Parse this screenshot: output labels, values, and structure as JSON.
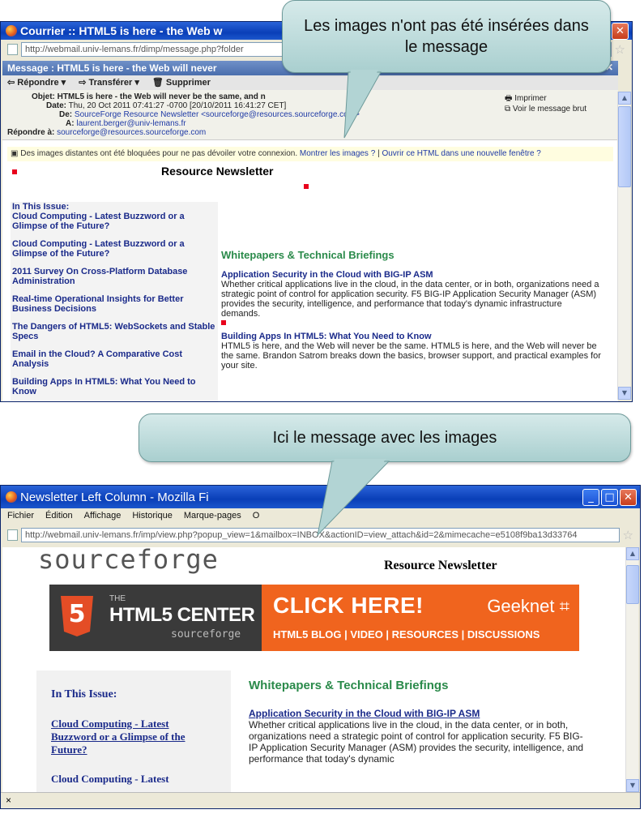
{
  "top_window": {
    "title": "Courrier :: HTML5 is here - the Web w",
    "url": "http://webmail.univ-lemans.fr/dimp/message.php?folder",
    "message_bar": "Message : HTML5 is here - the Web will never",
    "toolbar": {
      "reply": "Répondre",
      "forward": "Transférer",
      "delete": "Supprimer"
    },
    "headers": {
      "subject_label": "Objet:",
      "subject": "HTML5 is here - the Web will never be the same, and n",
      "date_label": "Date:",
      "date": "Thu, 20 Oct 2011 07:41:27 -0700 [20/10/2011 16:41:27 CET]",
      "from_label": "De:",
      "from": "SourceForge Resource Newsletter <sourceforge@resources.sourceforge.com>",
      "to_label": "À:",
      "to": "laurent.berger@univ-lemans.fr",
      "replyto_label": "Répondre à:",
      "replyto": "sourceforge@resources.sourceforge.com",
      "print": "Imprimer",
      "raw": "Voir le message brut"
    },
    "notice": {
      "text": "Des images distantes ont été bloquées pour ne pas dévoiler votre connexion.",
      "show_images": "Montrer les images ?",
      "separator": "|",
      "open_html": "Ouvrir ce HTML dans une nouvelle fenêtre ?"
    },
    "body": {
      "newsletter_title": "Resource Newsletter",
      "in_this_issue": "In This Issue:",
      "left_links": [
        "Cloud Computing - Latest Buzzword or a Glimpse of the Future?",
        "Cloud Computing - Latest Buzzword or a Glimpse of the Future?",
        "2011 Survey On Cross-Platform Database Administration",
        "Real-time Operational Insights for Better Business Decisions",
        "The Dangers of HTML5: WebSockets and Stable Specs",
        "Email in the Cloud? A Comparative Cost Analysis",
        "Building Apps In HTML5: What You Need to Know"
      ],
      "section_title": "Whitepapers & Technical Briefings",
      "articles": [
        {
          "title": "Application Security in the Cloud with BIG-IP ASM",
          "text": "Whether critical applications live in the cloud, in the data center, or in both, organizations need a strategic point of control for application security. F5 BIG-IP Application Security Manager (ASM) provides the security, intelligence, and performance that today's dynamic infrastructure demands."
        },
        {
          "title": "Building Apps In HTML5: What You Need to Know",
          "text": "HTML5 is here, and the Web will never be the same. HTML5 is here, and the Web will never be the same. Brandon Satrom breaks down the basics, browser support, and practical examples for your site."
        }
      ]
    }
  },
  "callouts": {
    "top": "Les images n'ont pas été insérées dans le message",
    "middle": "Ici le message avec les images"
  },
  "bottom_window": {
    "title": "Newsletter Left Column - Mozilla Fi",
    "menu": [
      "Fichier",
      "Édition",
      "Affichage",
      "Historique",
      "Marque-pages",
      "O"
    ],
    "url": "http://webmail.univ-lemans.fr/imp/view.php?popup_view=1&mailbox=INBOX&actionID=view_attach&id=2&mimecache=e5108f9ba13d33764",
    "logo": "sourceforge",
    "newsletter_title": "Resource Newsletter",
    "banner": {
      "badge": "5",
      "the": "THE",
      "center": "HTML5 CENTER",
      "sub": "sourceforge",
      "click": "CLICK HERE!",
      "brand": "Geeknet",
      "links": "HTML5 BLOG | VIDEO | RESOURCES | DISCUSSIONS"
    },
    "in_this_issue": "In This Issue:",
    "left_links": [
      "Cloud Computing - Latest Buzzword or a Glimpse of the Future?",
      "Cloud Computing - Latest"
    ],
    "section_title": "Whitepapers & Technical Briefings",
    "article_title": "Application Security in the Cloud with BIG-IP ASM",
    "article_text": "Whether critical applications live in the cloud, in the data center, or in both, organizations need a strategic point of control for application security. F5 BIG-IP Application Security Manager (ASM) provides the security, intelligence, and performance that today's dynamic",
    "status": "×"
  },
  "colors": {
    "link_navy": "#1a2a8a",
    "section_green": "#2a8a4a",
    "banner_orange": "#f0641e",
    "banner_dark": "#3a3a3a",
    "html5_orange": "#e44d26"
  }
}
